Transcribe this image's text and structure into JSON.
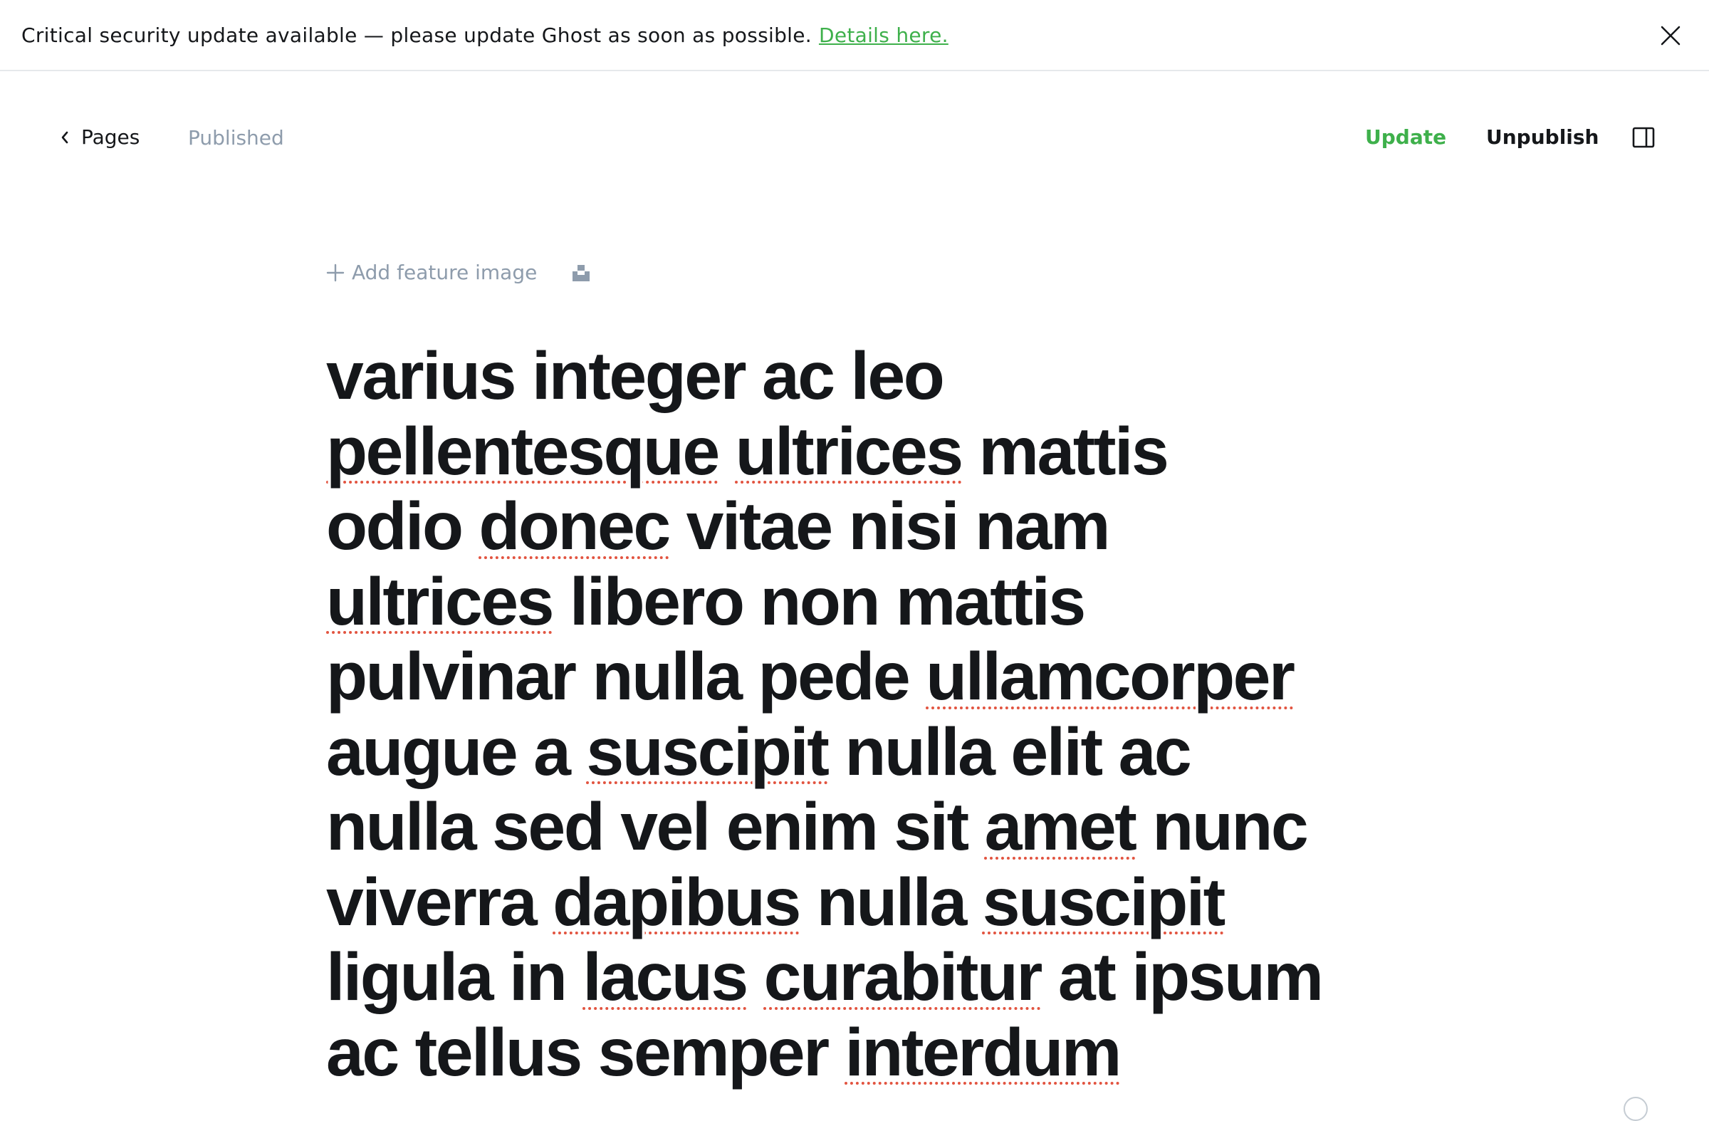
{
  "alert": {
    "message": "Critical security update available — please update Ghost as soon as possible.",
    "link_label": "Details here.",
    "close_icon": "close-icon"
  },
  "header": {
    "back_label": "Pages",
    "status": "Published",
    "update_label": "Update",
    "unpublish_label": "Unpublish",
    "sidebar_icon": "sidebar-toggle-icon"
  },
  "feature": {
    "add_label": "Add feature image",
    "plus_icon": "plus-icon",
    "unsplash_icon": "unsplash-icon"
  },
  "title": {
    "lines": [
      "varius integer ac leo",
      "pellentesque ultrices mattis",
      "odio donec vitae nisi nam",
      "ultrices libero non mattis",
      "pulvinar nulla pede ullamcorper",
      "augue a suscipit nulla elit ac",
      "nulla sed vel enim sit amet nunc",
      "viverra dapibus nulla suscipit",
      "ligula in lacus curabitur at ipsum",
      "ac tellus semper interdum"
    ],
    "misspelled": [
      "pellentesque",
      "ultrices",
      "donec",
      "ullamcorper",
      "suscipit",
      "amet",
      "dapibus",
      "lacus",
      "curabitur",
      "interdum"
    ]
  },
  "colors": {
    "accent": "#3eb04b",
    "muted": "#8e9cac",
    "text": "#15171a",
    "spellcheck": "#e25440"
  }
}
